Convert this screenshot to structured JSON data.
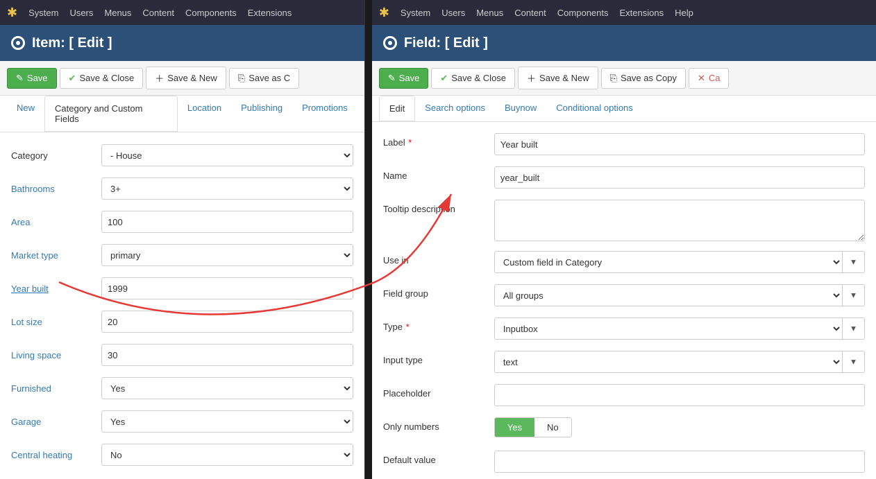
{
  "left_panel": {
    "navbar": {
      "items": [
        "System",
        "Users",
        "Menus",
        "Content",
        "Components",
        "Extensions"
      ]
    },
    "page_title": "Item:",
    "page_title_bracket": "[ Edit ]",
    "toolbar": {
      "save_label": "Save",
      "save_close_label": "Save & Close",
      "save_new_label": "Save & New",
      "save_as_label": "Save as C"
    },
    "tabs": [
      {
        "label": "New",
        "active": false
      },
      {
        "label": "Category and Custom Fields",
        "active": true
      },
      {
        "label": "Location",
        "active": false
      },
      {
        "label": "Publishing",
        "active": false
      },
      {
        "label": "Promotions",
        "active": false
      }
    ],
    "form": {
      "fields": [
        {
          "label": "Category",
          "type": "select",
          "value": "- House",
          "link": false
        },
        {
          "label": "Bathrooms",
          "type": "select",
          "value": "3+",
          "link": true
        },
        {
          "label": "Area",
          "type": "input",
          "value": "100",
          "link": true
        },
        {
          "label": "Market type",
          "type": "select",
          "value": "primary",
          "link": true
        },
        {
          "label": "Year built",
          "type": "input",
          "value": "1999",
          "link": true,
          "arrow": true
        },
        {
          "label": "Lot size",
          "type": "input",
          "value": "20",
          "link": true
        },
        {
          "label": "Living space",
          "type": "input",
          "value": "30",
          "link": true
        },
        {
          "label": "Furnished",
          "type": "select",
          "value": "Yes",
          "link": true
        },
        {
          "label": "Garage",
          "type": "select",
          "value": "Yes",
          "link": true
        },
        {
          "label": "Central heating",
          "type": "select",
          "value": "No",
          "link": true
        }
      ]
    }
  },
  "right_panel": {
    "navbar": {
      "items": [
        "System",
        "Users",
        "Menus",
        "Content",
        "Components",
        "Extensions",
        "Help"
      ]
    },
    "page_title": "Field:",
    "page_title_bracket": "[ Edit ]",
    "toolbar": {
      "save_label": "Save",
      "save_close_label": "Save & Close",
      "save_new_label": "Save & New",
      "save_copy_label": "Save as Copy",
      "cancel_label": "Ca"
    },
    "tabs": [
      {
        "label": "Edit",
        "active": true
      },
      {
        "label": "Search options",
        "active": false
      },
      {
        "label": "Buynow",
        "active": false
      },
      {
        "label": "Conditional options",
        "active": false
      }
    ],
    "form": {
      "label_field": "Year built",
      "name_field": "year_built",
      "tooltip_description": "",
      "use_in": "Custom field in Category",
      "field_group": "All groups",
      "type": "Inputbox",
      "input_type": "text",
      "placeholder": "",
      "only_numbers_yes": "Yes",
      "only_numbers_no": "No",
      "default_value": ""
    }
  }
}
